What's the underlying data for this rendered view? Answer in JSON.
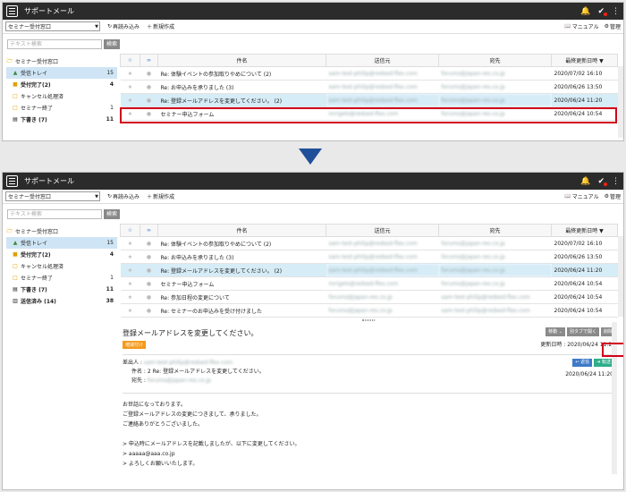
{
  "app": {
    "title": "サポートメール"
  },
  "toolbar": {
    "account_select": "セミナー受付窓口",
    "reload_label": "再読み込み",
    "new_label": "新規作成",
    "manual_label": "マニュアル",
    "admin_label": "管理"
  },
  "search": {
    "placeholder": "テキスト検索",
    "button": "検索"
  },
  "sidebar": {
    "root": "セミナー受付窓口",
    "items": [
      {
        "label": "受信トレイ",
        "count": "15"
      },
      {
        "label": "受付完了(2)",
        "count": "4"
      },
      {
        "label": "キャンセル処理済",
        "count": ""
      },
      {
        "label": "セミナー終了",
        "count": "1"
      },
      {
        "label": "下書き (7)",
        "count": "11"
      },
      {
        "label": "送信済み (14)",
        "count": "38"
      }
    ]
  },
  "table": {
    "headers": {
      "subject": "件名",
      "from": "送信元",
      "to": "宛先",
      "date": "最終更新日時"
    },
    "sort_icon": "▼",
    "rows": [
      {
        "subject": "Re: 体験イベントの参加取りやめについて (2)",
        "from": "sam-test-philip@redsed-flex.com",
        "to": "forums@japan-res.co.jp",
        "date": "2020/07/02 16:10"
      },
      {
        "subject": "Re: お申込みを承りました (3)",
        "from": "sam-test-philip@redsed-flex.com",
        "to": "forums@japan-res.co.jp",
        "date": "2020/06/26 13:50"
      },
      {
        "subject": "Re: 登録メールアドレスを変更してください。 (2)",
        "from": "sam-test-philip@redsed-flex.com",
        "to": "forums@japan-res.co.jp",
        "date": "2020/06/24 11:20"
      },
      {
        "subject": "セミナー申込フォーム",
        "from": "mrrgelo@redsed-flex.com",
        "to": "forums@japan-res.co.jp",
        "date": "2020/06/24 10:54"
      },
      {
        "subject": "Re: 参加日程の変更について",
        "from": "forums@japan-res.co.jp",
        "to": "sam-test-philip@redsed-flex.com",
        "date": "2020/06/24 10:54"
      },
      {
        "subject": "Re: セミナーのお申込みを受け付けました",
        "from": "forums@japan-res.co.jp",
        "to": "sam-test-philip@redsed-flex.com",
        "date": "2020/06/24 10:54"
      }
    ]
  },
  "detail": {
    "title": "登録メールアドレスを変更してください。",
    "tag": "増減付け",
    "move_btn": "移動",
    "newtab_btn": "別タブで開く",
    "delete_btn": "削除",
    "updated": "更新日時 : 2020/06/24 11:20",
    "from_label": "差出人 :",
    "from_value": "sam-test-philip@redsed-flex.com",
    "subject_label": "件名 : 2",
    "subject_value": "Re: 登録メールアドレスを変更してください。",
    "to_label": "宛先 :",
    "to_value": "forums@japan-res.co.jp",
    "reply_btn": "返信",
    "forward_btn": "転送",
    "header_date": "2020/06/24 11:20",
    "body_lines": [
      "お世話になっております。",
      "ご登録メールアドレスの変更につきまして、承りました。",
      "ご連絡ありがとうございました。",
      "",
      "> 申込時にメールアドレスを記載しましたが、以下に変更してください。",
      "> aaaaa@aaa.co.jp",
      "> よろしくお願いいたします。"
    ]
  },
  "colors": {
    "appbar": "#2b2b2b",
    "highlight": "#d0021b",
    "arrow": "#1f4f98",
    "selected_row": "#d6ecf7"
  }
}
